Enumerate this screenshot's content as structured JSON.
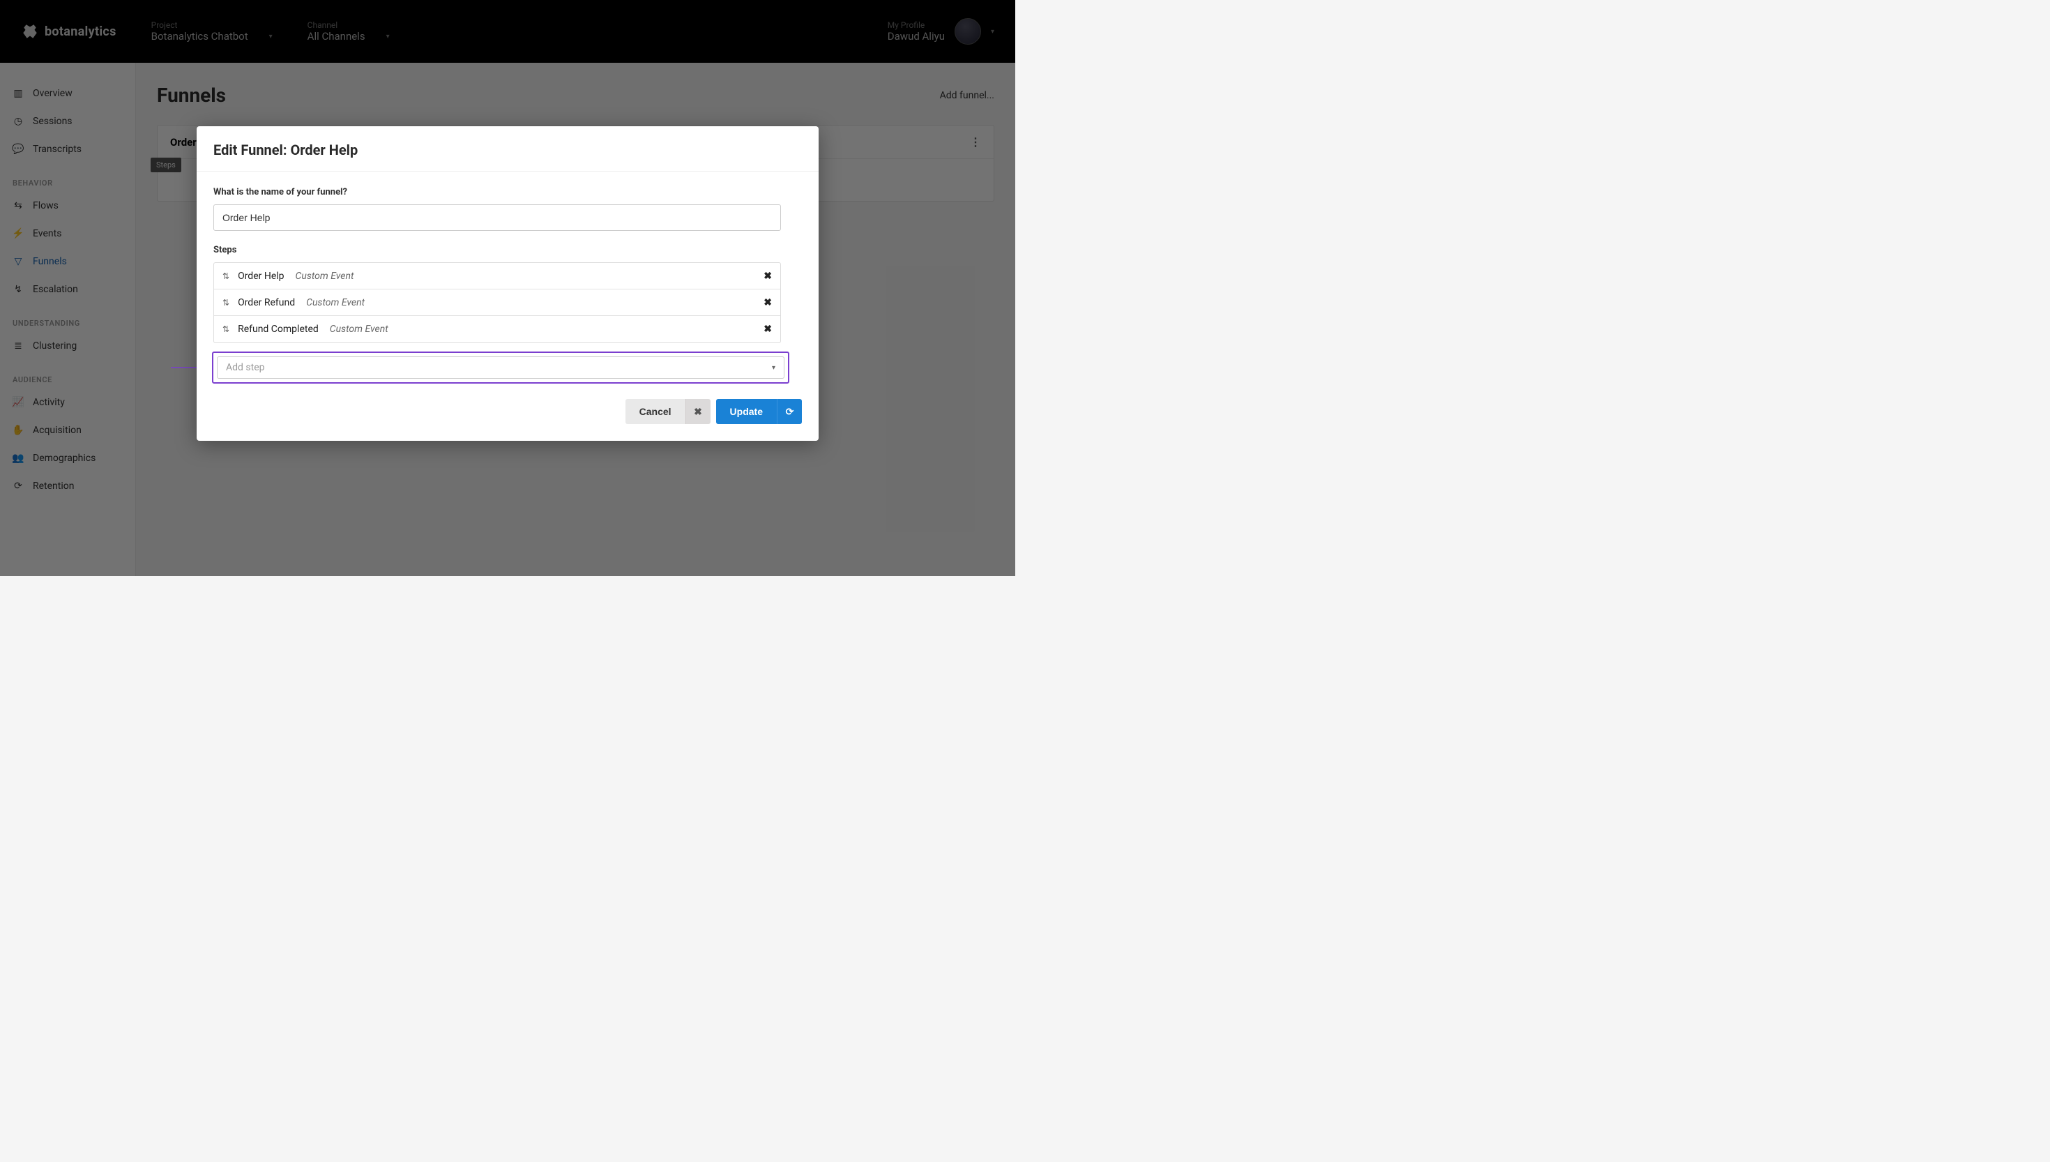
{
  "brand": "botanalytics",
  "nav": {
    "project": {
      "label": "Project",
      "value": "Botanalytics Chatbot"
    },
    "channel": {
      "label": "Channel",
      "value": "All Channels"
    },
    "profile": {
      "label": "My Profile",
      "value": "Dawud Aliyu"
    }
  },
  "sidebar": {
    "overview": "Overview",
    "sessions": "Sessions",
    "transcripts": "Transcripts",
    "group_behavior": "BEHAVIOR",
    "flows": "Flows",
    "events": "Events",
    "funnels": "Funnels",
    "escalation": "Escalation",
    "group_understanding": "UNDERSTANDING",
    "clustering": "Clustering",
    "group_audience": "AUDIENCE",
    "activity": "Activity",
    "acquisition": "Acquisition",
    "demographics": "Demographics",
    "retention": "Retention"
  },
  "page": {
    "title": "Funnels",
    "add_funnel": "Add funnel...",
    "card_title_prefix": "Order",
    "steps_tag": "Steps"
  },
  "modal": {
    "title": "Edit Funnel: Order Help",
    "name_label": "What is the name of your funnel?",
    "name_value": "Order Help",
    "steps_label": "Steps",
    "steps": [
      {
        "name": "Order Help",
        "type": "Custom Event"
      },
      {
        "name": "Order Refund",
        "type": "Custom Event"
      },
      {
        "name": "Refund Completed",
        "type": "Custom Event"
      }
    ],
    "add_step_placeholder": "Add step",
    "cancel": "Cancel",
    "update": "Update"
  }
}
